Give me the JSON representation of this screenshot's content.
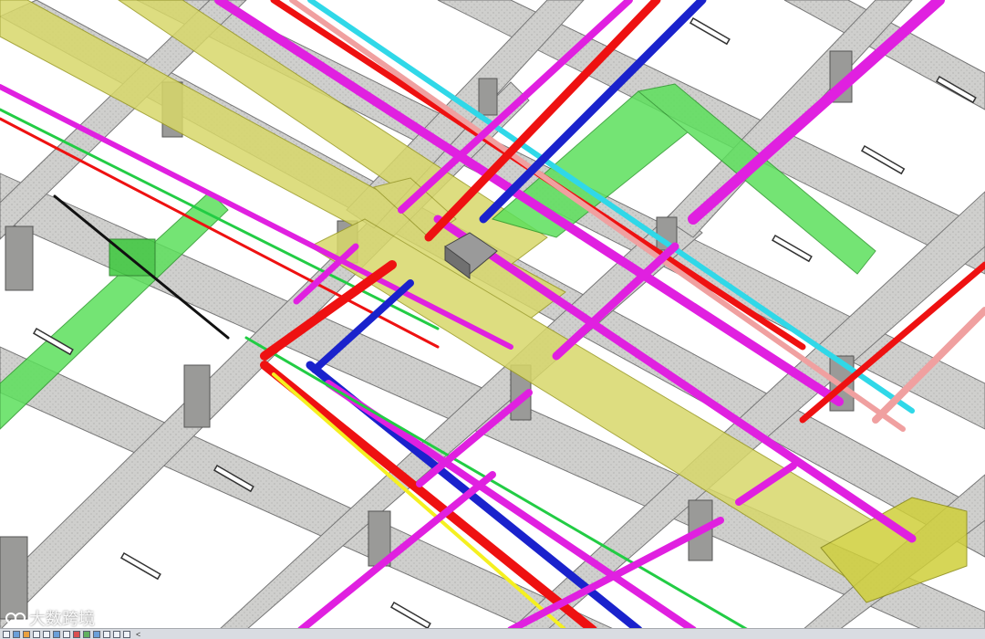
{
  "watermark": {
    "text": "大数跨境",
    "logo_icon": "brand-logo-icon"
  },
  "view": {
    "description_icons": [
      "beam-grid",
      "duct",
      "pipe",
      "cable-tray",
      "hanger"
    ],
    "colors": {
      "beam": "#c8c8c6",
      "beam_shadow": "#8e8e8c",
      "column": "#9a9a98",
      "duct_yellow": "#d8d86a",
      "duct_green": "#5ce05c",
      "pipe_magenta": "#e020e0",
      "pipe_red": "#ee1111",
      "pipe_blue": "#1a22cc",
      "pipe_cyan": "#30d8e8",
      "pipe_pink": "#f0a0a0",
      "pipe_green": "#22cc44",
      "pipe_black": "#111111",
      "box_gray": "#8a8a8a"
    }
  },
  "statusbar": {
    "icons": [
      "view-scale-icon",
      "detail-level-icon",
      "visual-style-icon",
      "sun-path-icon",
      "shadows-icon",
      "render-icon",
      "crop-icon",
      "show-crop-icon",
      "unlock-3d-icon",
      "temporary-hide-icon",
      "reveal-hidden-icon",
      "analytical-model-icon",
      "highlight-icon"
    ],
    "scroll_glyph": "<"
  }
}
